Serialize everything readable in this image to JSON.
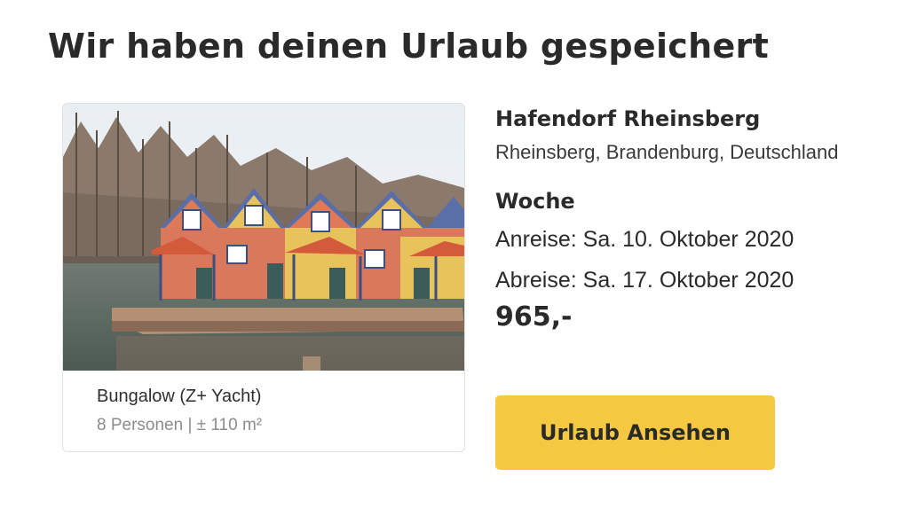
{
  "page_title": "Wir haben deinen Urlaub gespeichert",
  "card": {
    "image_subject": "Hafendorf Rheinsberg bungalows on the water",
    "unit_name": "Bungalow (Z+ Yacht)",
    "unit_details": "8 Personen | ± 110 m²"
  },
  "info": {
    "park_name": "Hafendorf Rheinsberg",
    "location": "Rheinsberg, Brandenburg, Deutschland",
    "duration": "Woche",
    "arrival": "Anreise: Sa. 10. Oktober 2020",
    "departure": "Abreise: Sa. 17. Oktober 2020",
    "price": "965,-"
  },
  "button": {
    "label": "Urlaub Ansehen"
  },
  "colors": {
    "button_background": "#f5c842",
    "text": "#2a2a2a",
    "muted_text": "#8c8c8c",
    "card_border": "#e1e1e1"
  }
}
